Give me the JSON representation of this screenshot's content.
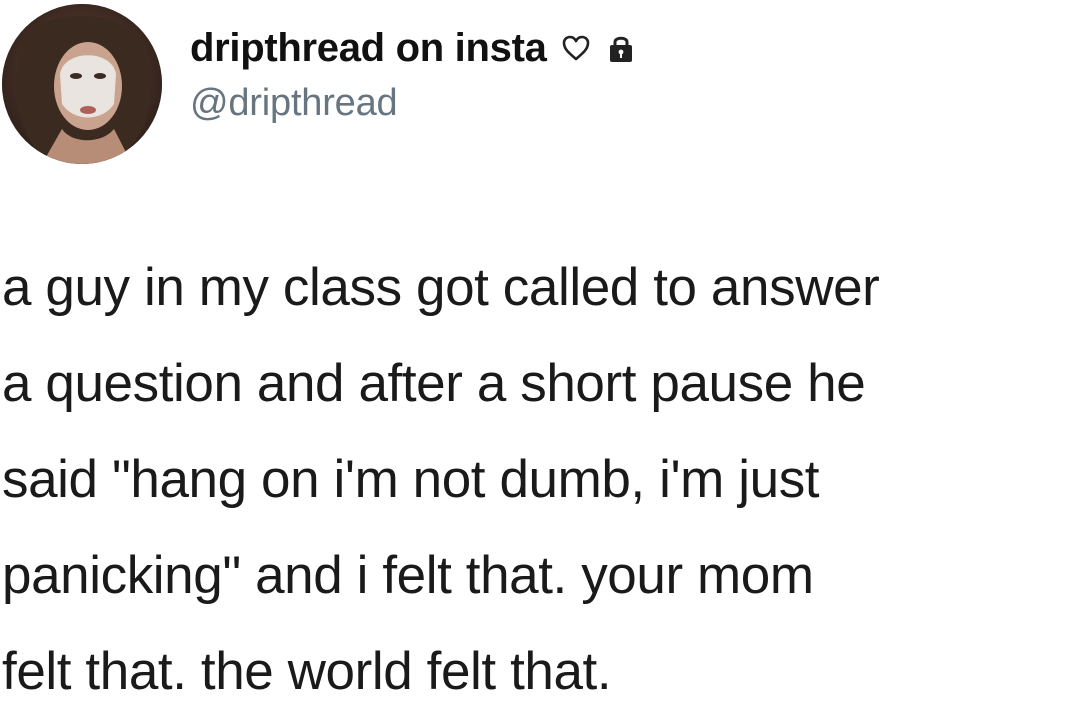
{
  "tweet": {
    "display_name": "dripthread on insta",
    "handle": "@dripthread",
    "icons": [
      "heart-icon",
      "lock-icon"
    ],
    "avatar": "profile-avatar",
    "body_lines": [
      "a guy in my class got called to answer",
      "a question and after a short pause he",
      "said \"hang on i'm not dumb, i'm just",
      "panicking\" and i felt that. your mom",
      "felt that. the world felt that."
    ]
  },
  "colors": {
    "name": "#111111",
    "handle": "#66757f",
    "body": "#1a1a1a",
    "background": "#ffffff"
  }
}
